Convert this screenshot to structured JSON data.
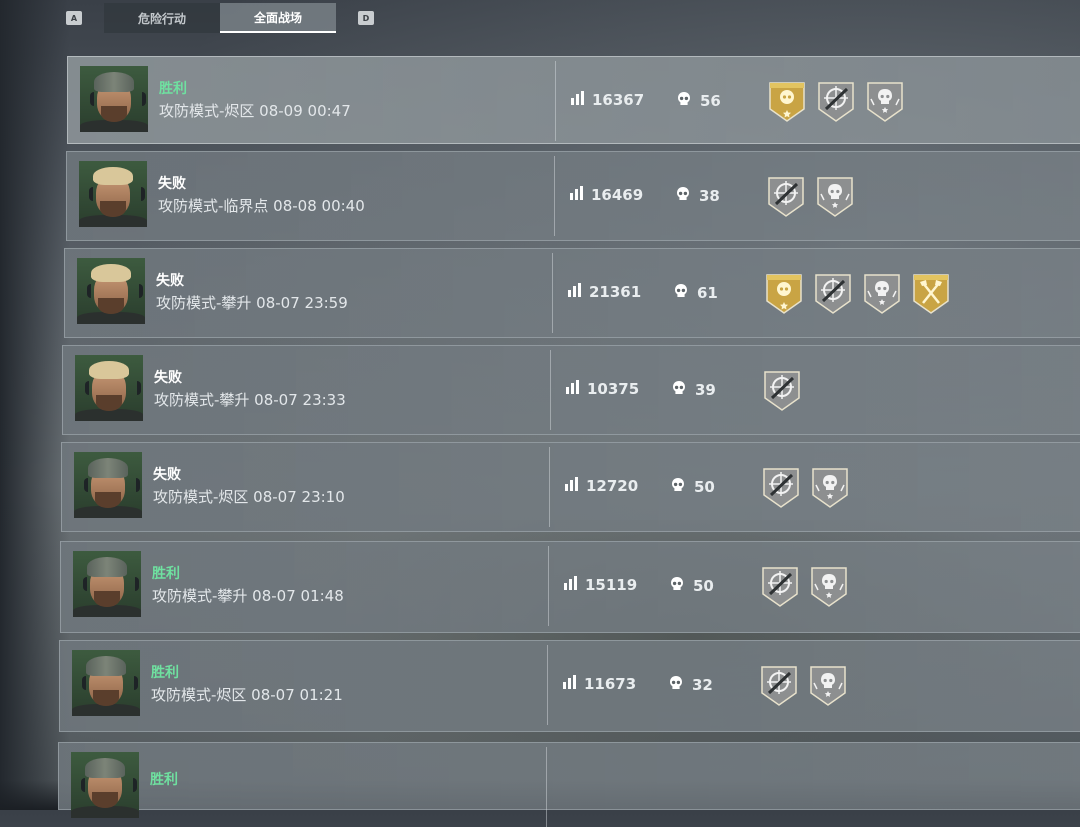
{
  "tabs": {
    "left_key": "A",
    "right_key": "D",
    "items": [
      {
        "label": "危险行动",
        "active": false
      },
      {
        "label": "全面战场",
        "active": true
      }
    ]
  },
  "matches": [
    {
      "result": "胜利",
      "outcome": "win",
      "detail": "攻防模式-烬区 08-09 00:47",
      "score": "16367",
      "kills": "56",
      "avatar": "cap",
      "medals": [
        "gold-skull",
        "crosshair-rifle",
        "skull-star"
      ]
    },
    {
      "result": "失败",
      "outcome": "loss",
      "detail": "攻防模式-临界点 08-08 00:40",
      "score": "16469",
      "kills": "38",
      "avatar": "blond",
      "medals": [
        "crosshair-rifle",
        "skull-star"
      ]
    },
    {
      "result": "失败",
      "outcome": "loss",
      "detail": "攻防模式-攀升 08-07 23:59",
      "score": "21361",
      "kills": "61",
      "avatar": "blond",
      "medals": [
        "gold-skull",
        "crosshair-rifle",
        "skull-star",
        "gold-axes"
      ]
    },
    {
      "result": "失败",
      "outcome": "loss",
      "detail": "攻防模式-攀升 08-07 23:33",
      "score": "10375",
      "kills": "39",
      "avatar": "blond",
      "medals": [
        "crosshair-rifle"
      ]
    },
    {
      "result": "失败",
      "outcome": "loss",
      "detail": "攻防模式-烬区 08-07 23:10",
      "score": "12720",
      "kills": "50",
      "avatar": "cap",
      "medals": [
        "crosshair-rifle",
        "skull-star"
      ]
    },
    {
      "result": "胜利",
      "outcome": "win",
      "detail": "攻防模式-攀升 08-07 01:48",
      "score": "15119",
      "kills": "50",
      "avatar": "cap",
      "medals": [
        "crosshair-rifle",
        "skull-star"
      ]
    },
    {
      "result": "胜利",
      "outcome": "win",
      "detail": "攻防模式-烬区 08-07 01:21",
      "score": "11673",
      "kills": "32",
      "avatar": "cap",
      "medals": [
        "crosshair-rifle",
        "skull-star"
      ]
    },
    {
      "result": "胜利",
      "outcome": "win",
      "detail": "",
      "score": "",
      "kills": "",
      "avatar": "cap",
      "medals": []
    }
  ],
  "colors": {
    "win": "#6fe0a0",
    "gold_medal": "#c9a444",
    "silver_medal": "#8d8f90"
  }
}
